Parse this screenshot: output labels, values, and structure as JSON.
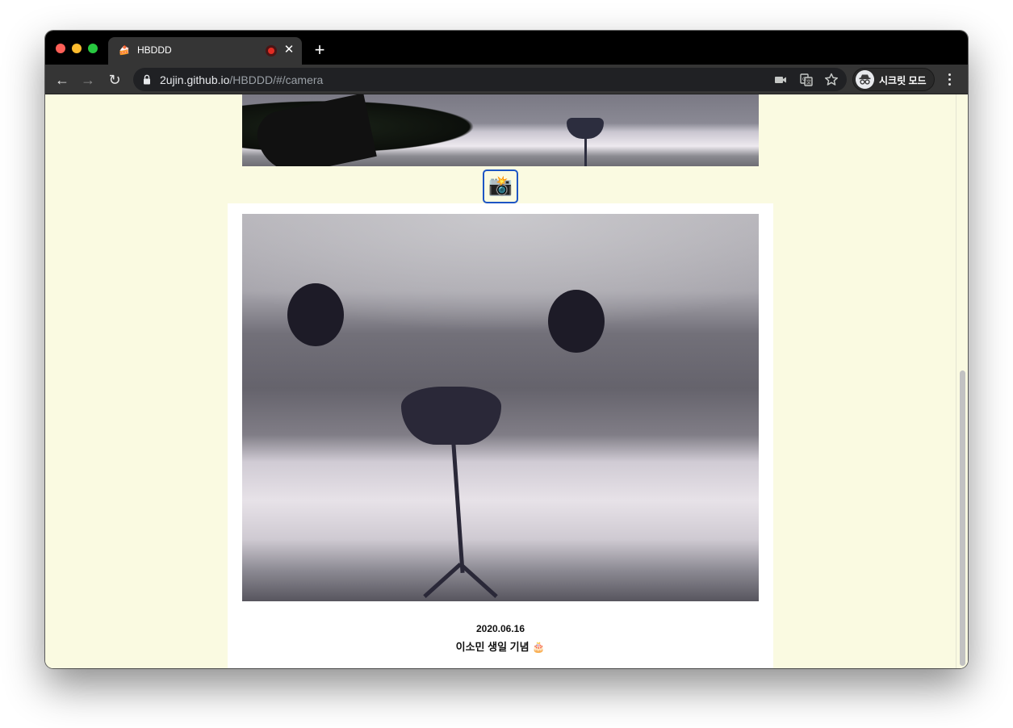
{
  "window": {
    "controls": [
      "close",
      "minimize",
      "maximize"
    ]
  },
  "tab": {
    "title": "HBDDD",
    "favicon": "🍰",
    "recording_icon": "recording-dot-icon",
    "close_label": "✕"
  },
  "new_tab_label": "+",
  "toolbar": {
    "back": "←",
    "forward": "→",
    "reload": "↻",
    "url_host": "2ujin.github.io",
    "url_path": "/HBDDD/#/camera",
    "incognito_label": "시크릿 모드"
  },
  "page": {
    "capture_button_icon": "📸",
    "photo": {
      "date": "2020.06.16",
      "caption": "이소민 생일 기념 🎂"
    }
  },
  "colors": {
    "page_background": "#fafae1",
    "capture_button_border": "#1d55c4",
    "card_background": "#ffffff"
  }
}
